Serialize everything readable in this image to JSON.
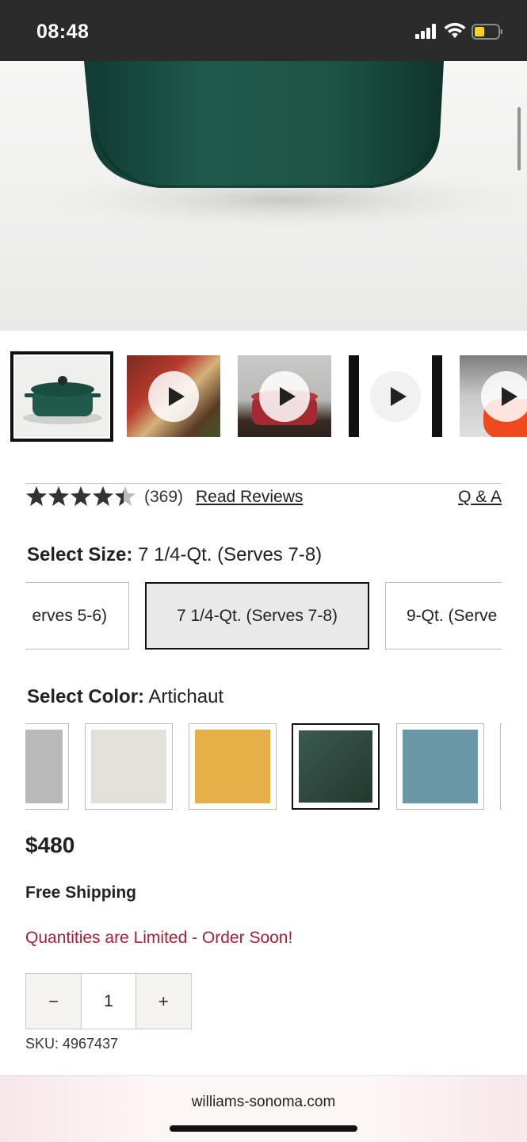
{
  "status_bar": {
    "time": "08:48"
  },
  "product": {
    "rating": {
      "average": 4.7,
      "count_text": "(369)",
      "read_reviews": "Read Reviews",
      "qa": "Q & A"
    },
    "size": {
      "label": "Select Size:",
      "selected": "7 1/4-Qt. (Serves 7-8)",
      "options": [
        "erves 5-6)",
        "7 1/4-Qt. (Serves 7-8)",
        "9-Qt. (Serve"
      ]
    },
    "color": {
      "label": "Select Color:",
      "selected": "Artichaut",
      "swatches": [
        "#b9b9b9",
        "#e4e1dc",
        "#e6b048",
        "#2f4a42",
        "#6a97a5"
      ]
    },
    "price": "$480",
    "shipping": "Free Shipping",
    "notice": "Quantities are Limited - Order Soon!",
    "quantity": {
      "minus": "−",
      "value": "1",
      "plus": "+"
    },
    "sku": "SKU: 4967437"
  },
  "browser": {
    "url": "williams-sonoma.com"
  },
  "colors": {
    "accent_red": "#a41f35",
    "pot_green": "#1f5a4c"
  }
}
